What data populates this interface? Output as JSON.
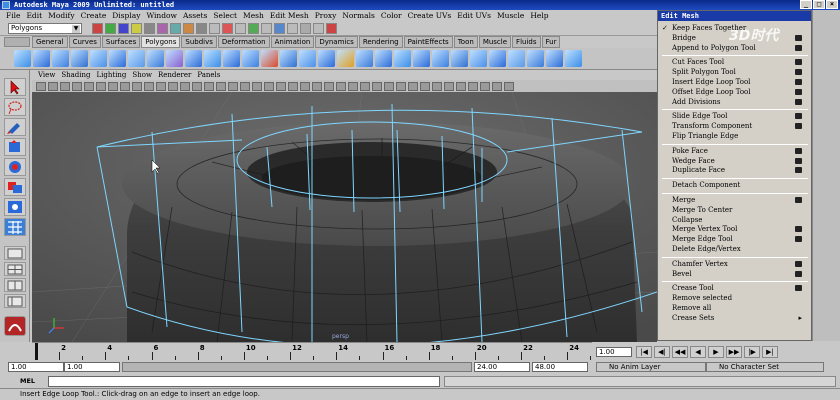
{
  "window": {
    "title": "Autodesk Maya 2009 Unlimited: untitled",
    "controls": [
      "_",
      "□",
      "×"
    ]
  },
  "menubar": [
    "File",
    "Edit",
    "Modify",
    "Create",
    "Display",
    "Window",
    "Assets",
    "Select",
    "Mesh",
    "Edit Mesh",
    "Proxy",
    "Normals",
    "Color",
    "Create UVs",
    "Edit UVs",
    "Muscle",
    "Help"
  ],
  "status_line": {
    "mode": "Polygons"
  },
  "shelf": {
    "tabs": [
      "General",
      "Curves",
      "Surfaces",
      "Polygons",
      "Subdivs",
      "Deformation",
      "Animation",
      "Dynamics",
      "Rendering",
      "PaintEffects",
      "Toon",
      "Muscle",
      "Fluids",
      "Fur"
    ],
    "active_tab": "Polygons"
  },
  "panel_menu": [
    "View",
    "Shading",
    "Lighting",
    "Show",
    "Renderer",
    "Panels"
  ],
  "viewport": {
    "axis_label": "persp"
  },
  "edit_mesh_menu": {
    "title": "Edit Mesh",
    "items": [
      {
        "label": "Keep Faces Together",
        "checked": true,
        "option": false
      },
      {
        "label": "Bridge",
        "option": true
      },
      {
        "label": "Append to Polygon Tool",
        "option": true
      },
      {
        "sep": true
      },
      {
        "label": "Cut Faces Tool",
        "option": true
      },
      {
        "label": "Split Polygon Tool",
        "option": true
      },
      {
        "label": "Insert Edge Loop Tool",
        "option": true
      },
      {
        "label": "Offset Edge Loop Tool",
        "option": true
      },
      {
        "label": "Add Divisions",
        "option": true
      },
      {
        "sep": true
      },
      {
        "label": "Slide Edge Tool",
        "option": true
      },
      {
        "label": "Transform Component",
        "option": true
      },
      {
        "label": "Flip Triangle Edge",
        "option": false
      },
      {
        "sep": true
      },
      {
        "label": "Poke Face",
        "option": true
      },
      {
        "label": "Wedge Face",
        "option": true
      },
      {
        "label": "Duplicate Face",
        "option": true
      },
      {
        "sep": true
      },
      {
        "label": "Detach Component",
        "option": false
      },
      {
        "sep": true
      },
      {
        "label": "Merge",
        "option": true
      },
      {
        "label": "Merge To Center",
        "option": false
      },
      {
        "label": "Collapse",
        "option": false
      },
      {
        "label": "Merge Vertex Tool",
        "option": true
      },
      {
        "label": "Merge Edge Tool",
        "option": true
      },
      {
        "label": "Delete Edge/Vertex",
        "option": false
      },
      {
        "sep": true
      },
      {
        "label": "Chamfer Vertex",
        "option": true
      },
      {
        "label": "Bevel",
        "option": true
      },
      {
        "sep": true
      },
      {
        "label": "Crease Tool",
        "option": true
      },
      {
        "label": "Remove selected",
        "option": false
      },
      {
        "label": "Remove all",
        "option": false
      },
      {
        "label": "Crease Sets",
        "submenu": true
      }
    ]
  },
  "watermark": "3D时代",
  "time_slider": {
    "ticks": [
      "2",
      "4",
      "6",
      "8",
      "10",
      "12",
      "14",
      "16",
      "18",
      "20",
      "22",
      "24"
    ],
    "current_time": "1.00"
  },
  "playback_buttons": [
    "|◀",
    "◀|",
    "◀◀",
    "◀",
    "▶",
    "▶▶",
    "|▶",
    "▶|"
  ],
  "range": {
    "start": "1.00",
    "playback_start": "1.00",
    "range_end": "24.00",
    "end": "48.00",
    "anim_layer": "No Anim Layer",
    "character_set": "No Character Set"
  },
  "command_line": {
    "label": "MEL"
  },
  "help_line": "Insert Edge Loop Tool.: Click-drag on an edge to insert an edge loop.",
  "colors": {
    "title_bar": "#1e4bc2",
    "viewport_bg": "#5c5c5c",
    "mesh_fill": "#3e3e3e",
    "cage_wire": "#7fd6ff",
    "menu_bg": "#d4d0c8"
  }
}
